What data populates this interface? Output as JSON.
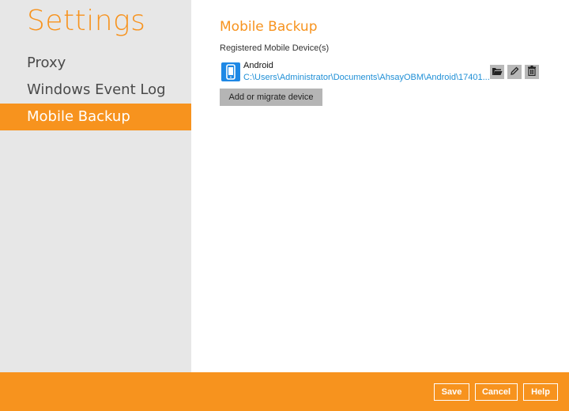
{
  "sidebar": {
    "title": "Settings",
    "items": [
      {
        "label": "Proxy"
      },
      {
        "label": "Windows Event Log"
      },
      {
        "label": "Mobile Backup"
      }
    ]
  },
  "main": {
    "title": "Mobile Backup",
    "section_label": "Registered Mobile Device(s)",
    "device": {
      "name": "Android",
      "path": "C:\\Users\\Administrator\\Documents\\AhsayOBM\\Android\\17401...",
      "icon": "mobile-phone-icon",
      "actions": [
        "open-folder-icon",
        "edit-pencil-icon",
        "trash-icon"
      ]
    },
    "add_button_label": "Add or migrate device"
  },
  "footer": {
    "save_label": "Save",
    "cancel_label": "Cancel",
    "help_label": "Help"
  },
  "colors": {
    "accent": "#f7931e",
    "sidebar_bg": "#e7e7e7",
    "link": "#1f8fd6",
    "device_icon_bg": "#1e88e5"
  }
}
